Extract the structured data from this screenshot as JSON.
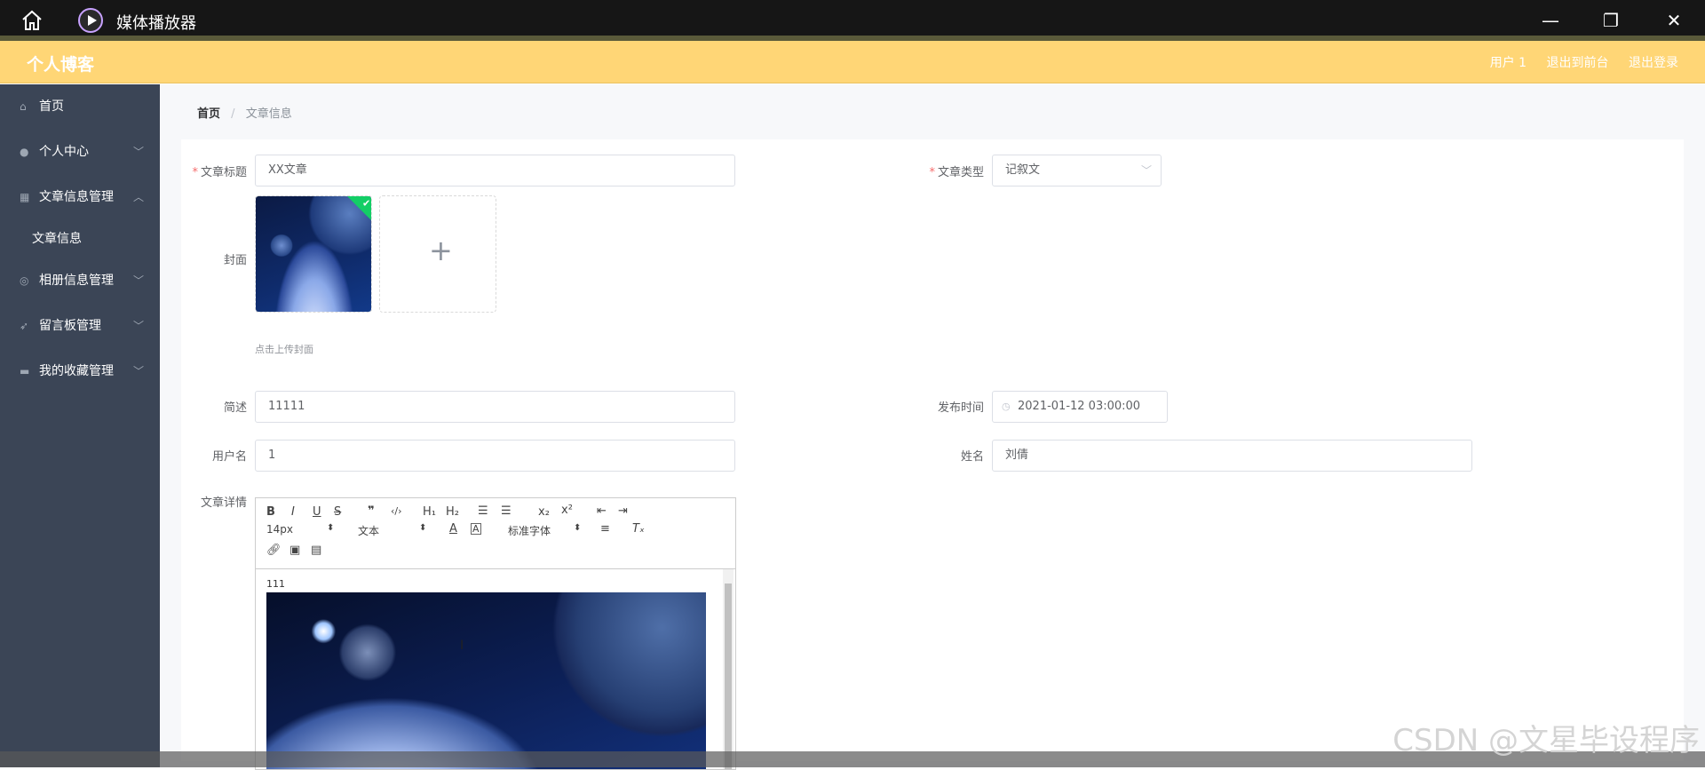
{
  "app": {
    "title": "媒体播放器"
  },
  "header": {
    "brand": "个人博客",
    "links": [
      "用户 1",
      "退出到前台",
      "退出登录"
    ]
  },
  "sidebar": {
    "items": [
      {
        "label": "首页",
        "icon": "home-icon"
      },
      {
        "label": "个人中心",
        "icon": "user-icon"
      },
      {
        "label": "文章信息管理",
        "icon": "grid-icon"
      },
      {
        "label": "文章信息",
        "icon": ""
      },
      {
        "label": "相册信息管理",
        "icon": "compass-icon"
      },
      {
        "label": "留言板管理",
        "icon": "send-icon"
      },
      {
        "label": "我的收藏管理",
        "icon": "chat-icon"
      }
    ]
  },
  "breadcrumb": {
    "home": "首页",
    "current": "文章信息"
  },
  "form": {
    "title_label": "文章标题",
    "title_value": "XX文章",
    "type_label": "文章类型",
    "type_value": "记叙文",
    "cover_label": "封面",
    "cover_hint": "点击上传封面",
    "summary_label": "简述",
    "summary_value": "11111",
    "publish_label": "发布时间",
    "publish_value": "2021-01-12 03:00:00",
    "username_label": "用户名",
    "username_value": "1",
    "name_label": "姓名",
    "name_value": "刘倩",
    "detail_label": "文章详情"
  },
  "editor": {
    "font_size": "14px",
    "block_format": "文本",
    "font_family": "标准字体",
    "body_text": "111"
  },
  "watermark": "CSDN @文星毕设程序"
}
